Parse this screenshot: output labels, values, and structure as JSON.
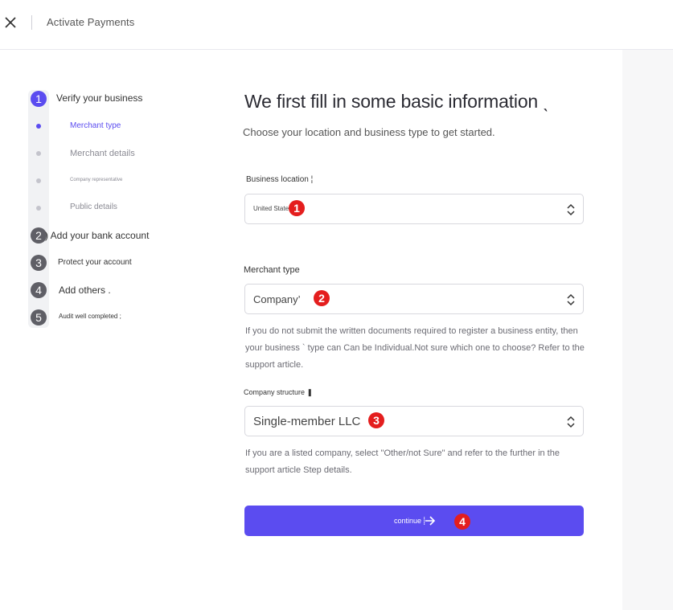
{
  "header": {
    "title": "Activate Payments",
    "close_icon": "close-icon"
  },
  "stepper": {
    "steps": [
      {
        "number": "1",
        "label": "Verify your business",
        "active": true
      },
      {
        "number": "2",
        "label": ") Add your bank account",
        "active": false
      },
      {
        "number": "3",
        "label": "Protect your account",
        "active": false
      },
      {
        "number": "4",
        "label": "Add others .",
        "active": false
      },
      {
        "number": "5",
        "label": "Audit well completed ;",
        "active": false
      }
    ],
    "substeps": [
      {
        "label": "Merchant type",
        "active": true
      },
      {
        "label": "Merchant details",
        "active": false
      },
      {
        "label": "Company representative",
        "active": false
      },
      {
        "label": "Public details",
        "active": false
      }
    ]
  },
  "form": {
    "heading": "We first fill in some basic information ˎ",
    "subheading": "Choose your location and business type to get started.",
    "business_location": {
      "label": "Business location ¦",
      "value": "United States",
      "marker": "1"
    },
    "merchant_type": {
      "label": "Merchant type",
      "value": "Company’",
      "marker": "2",
      "help": "If you do not submit the written documents required to register a business entity, then your business ` type can Can be Individual.Not sure which one to choose? Refer to the support article."
    },
    "company_structure": {
      "label": "Company structure ❚",
      "value": "Single-member LLC",
      "marker": "3",
      "help": "If you are a listed company, select \"Other/not Sure\" and refer to the further in the support article Step details."
    },
    "continue": {
      "label": "continue ⸽",
      "marker": "4",
      "icon": "arrow-right-icon"
    }
  },
  "colors": {
    "accent": "#5b4cf0",
    "marker": "#e41e1e",
    "step_inactive": "#5f5f66"
  }
}
